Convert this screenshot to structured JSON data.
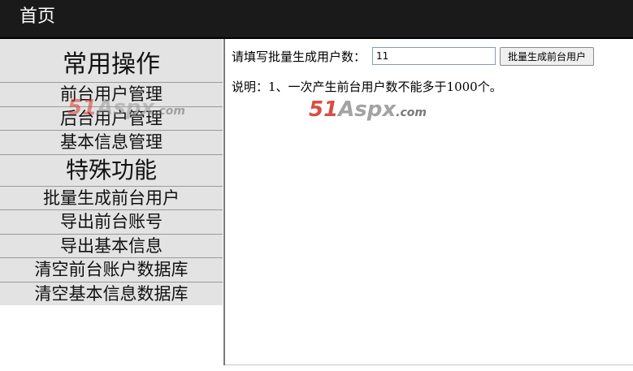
{
  "header": {
    "title": "首页"
  },
  "sidebar": {
    "section1_title": "常用操作",
    "section1_items": [
      "前台用户管理",
      "后台用户管理",
      "基本信息管理"
    ],
    "section2_title": "特殊功能",
    "section2_items": [
      "批量生成前台用户",
      "导出前台账号",
      "导出基本信息",
      "清空前台账户数据库",
      "清空基本信息数据库"
    ]
  },
  "main": {
    "form_label": "请填写批量生成用户数：",
    "count_value": "11",
    "generate_button": "批量生成前台用户",
    "note": "说明：1、一次产生前台用户数不能多于1000个。"
  },
  "watermark": {
    "num": "51",
    "asp": "Aspx",
    "dom": ".com"
  },
  "colors": {
    "header_bg": "#1a1a1a",
    "sidebar_bg": "#e3e3e3",
    "watermark_red": "#d43a2f"
  }
}
